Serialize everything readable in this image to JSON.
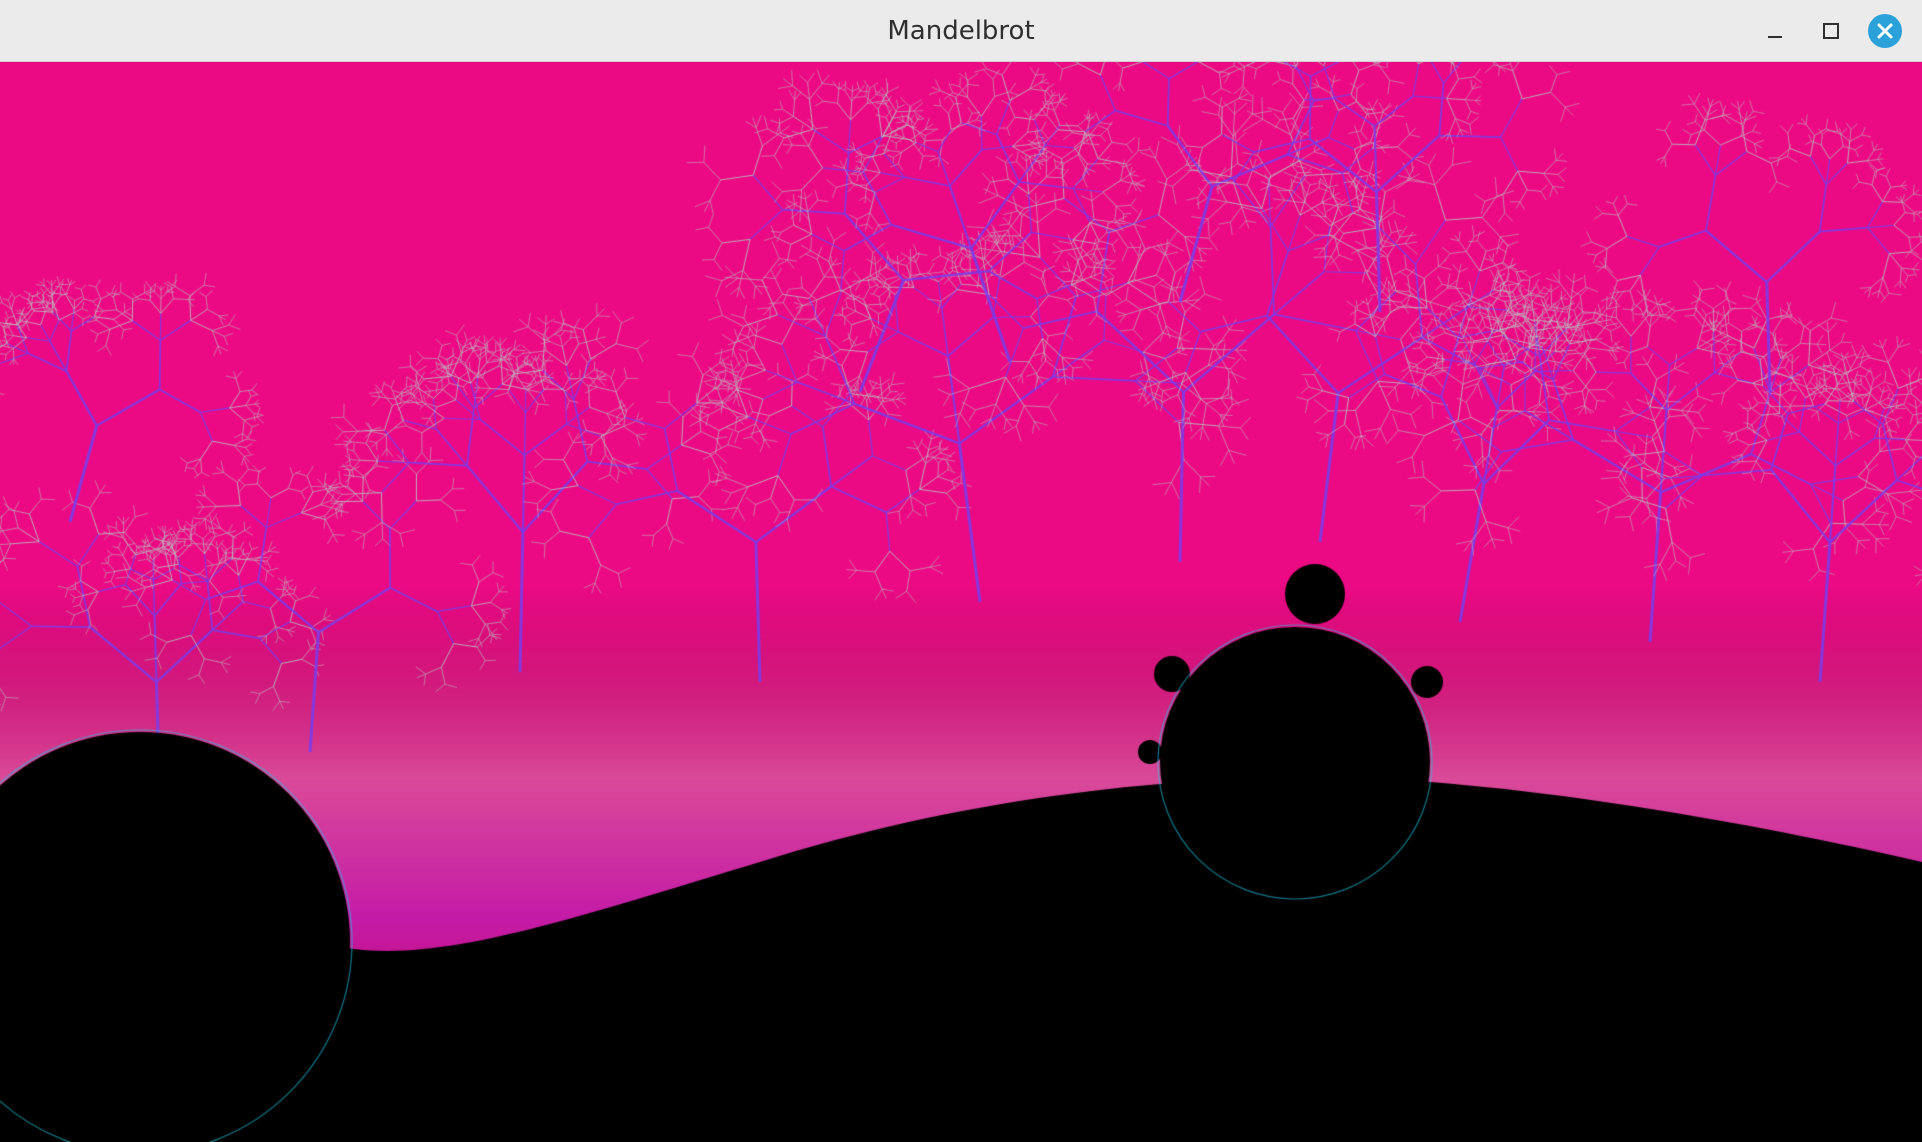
{
  "window": {
    "title": "Mandelbrot",
    "controls": {
      "minimize_icon": "minimize-icon",
      "maximize_icon": "maximize-icon",
      "close_icon": "close-icon",
      "close_color": "#2aa1d8"
    }
  },
  "render": {
    "palette": {
      "background": "#ec0a84",
      "near_boundary": "#b8c2bf",
      "boundary": "#7b3ce8",
      "edge": "#1ec6e6",
      "interior": "#000000"
    }
  }
}
